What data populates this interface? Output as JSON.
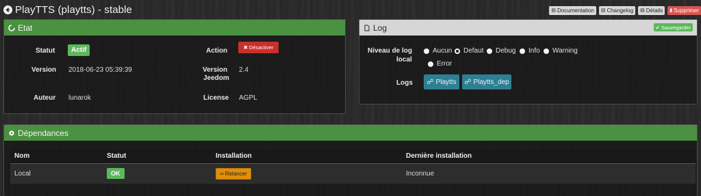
{
  "header": {
    "title": "PlayTTS (playtts) - stable",
    "back_icon": "arrow-left-circle-icon"
  },
  "toolbar": {
    "documentation": "Documentation",
    "changelog": "Changelog",
    "details": "Détails",
    "delete": "Supprimer",
    "delete_color": "#d9534f"
  },
  "etat": {
    "title": "Etat",
    "statut_label": "Statut",
    "statut_value": "Actif",
    "action_label": "Action",
    "action_button": "Désactiver",
    "version_label": "Version",
    "version_value": "2018-06-23 05:39:39",
    "jeedom_version_label_1": "Version",
    "jeedom_version_label_2": "Jeedom",
    "jeedom_version_value": "2.4",
    "auteur_label": "Auteur",
    "auteur_value": "lunarok",
    "license_label": "License",
    "license_value": "AGPL"
  },
  "log": {
    "title": "Log",
    "save_button": "Sauvegarder",
    "level_label_1": "Niveau de log",
    "level_label_2": "local",
    "levels": [
      "Aucun",
      "Defaut",
      "Debug",
      "Info",
      "Warning",
      "Error"
    ],
    "selected_level": "Defaut",
    "logs_label": "Logs",
    "log_buttons": [
      "Playtts",
      "Playtts_dep"
    ]
  },
  "dependances": {
    "title": "Dépendances",
    "columns": [
      "Nom",
      "Statut",
      "Installation",
      "Dernière installation"
    ],
    "rows": [
      {
        "nom": "Local",
        "statut": "OK",
        "installation": "Relancer",
        "derniere": "Inconnue"
      }
    ]
  },
  "colors": {
    "panel_header_green": "#4a9141",
    "success": "#5cb85c",
    "danger": "#c9302c",
    "log_button": "#2e7f93",
    "warning": "#e08e0b"
  }
}
